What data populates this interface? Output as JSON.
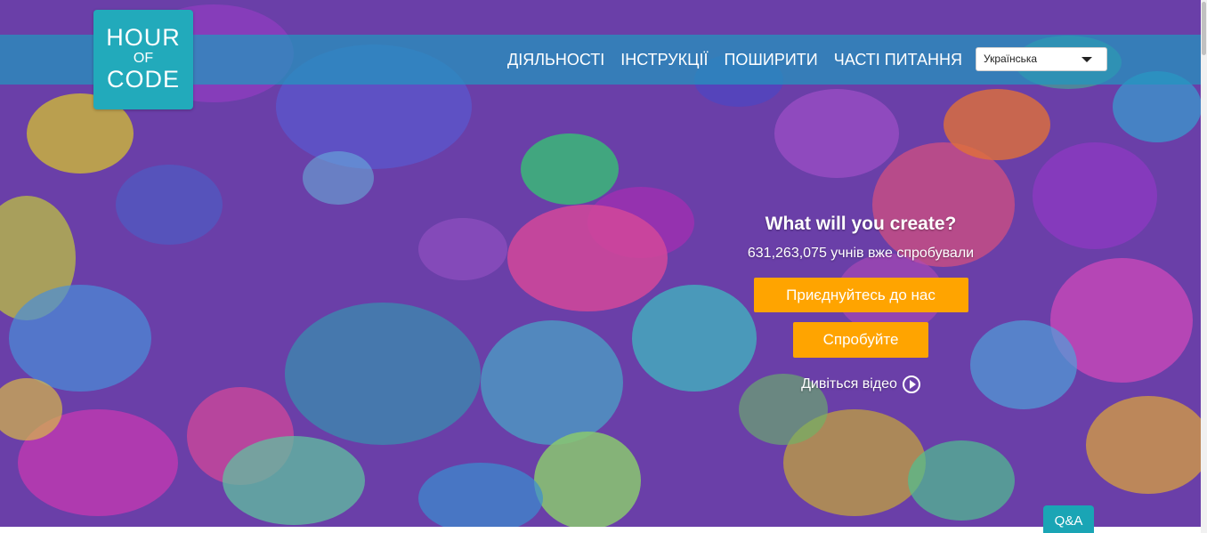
{
  "logo": {
    "line1": "HOUR",
    "line2": "OF",
    "line3": "CODE"
  },
  "nav": {
    "items": [
      {
        "label": "ДІЯЛЬНОСТІ"
      },
      {
        "label": "ІНСТРУКЦІЇ"
      },
      {
        "label": "ПОШИРИТИ"
      },
      {
        "label": "ЧАСТІ ПИТАННЯ"
      }
    ],
    "language": {
      "selected": "Українська",
      "icon": "caret-down-icon"
    }
  },
  "hero": {
    "title": "What will you create?",
    "counter": "631,263,075 учнів вже спробували",
    "join_button": "Приєднуйтесь до нас",
    "try_button": "Спробуйте",
    "watch_video": "Дивіться відео",
    "watch_icon": "play-circle-icon"
  },
  "qa_button": "Q&A",
  "colors": {
    "navbar": "#2296be",
    "logo_bg": "#22aabb",
    "button_orange": "#ffa400",
    "background_purple": "#6a3fa8",
    "qa_bg": "#1aa5b5"
  }
}
